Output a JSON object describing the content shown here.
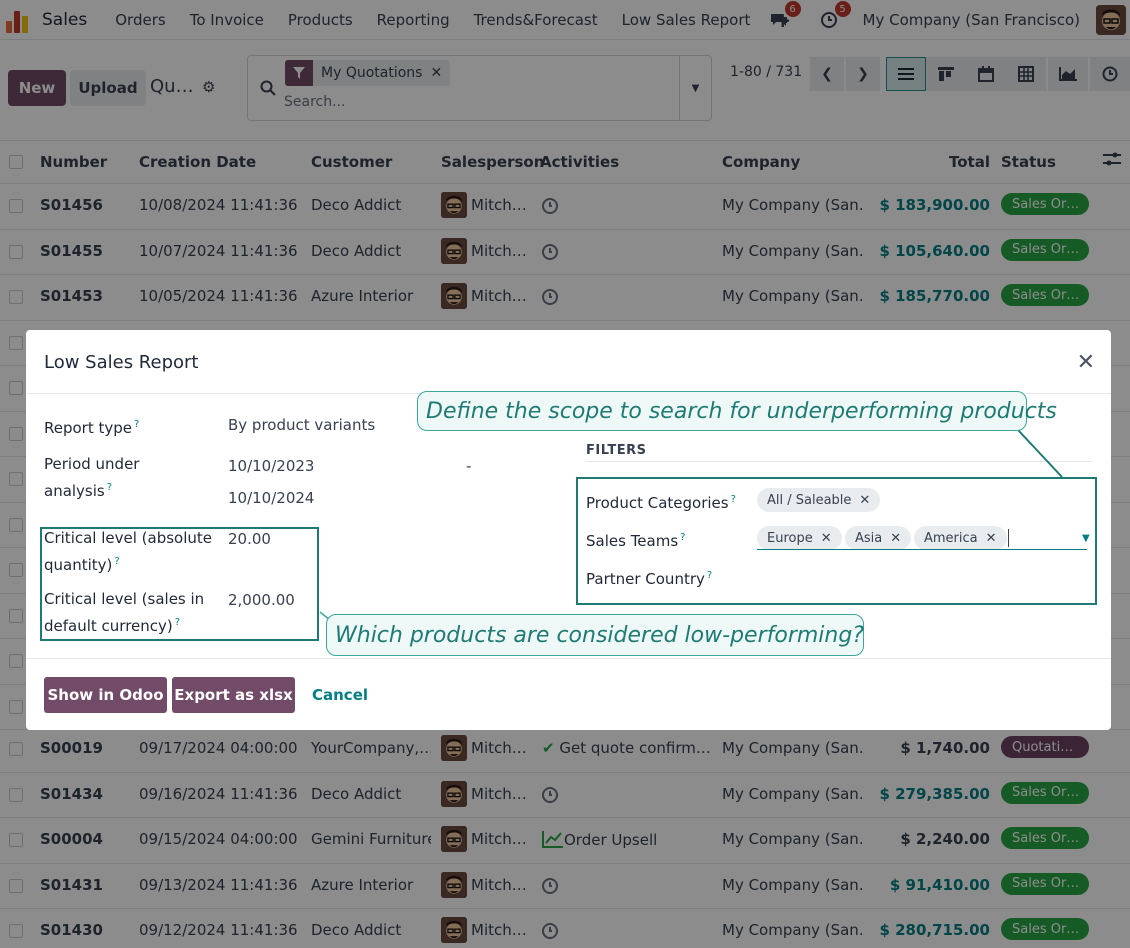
{
  "topnav": {
    "app_name": "Sales",
    "items": [
      "Orders",
      "To Invoice",
      "Products",
      "Reporting",
      "Trends&Forecast",
      "Low Sales Report"
    ],
    "chat_count": "6",
    "activity_count": "5",
    "company": "My Company (San Francisco)"
  },
  "control_panel": {
    "new_label": "New",
    "upload_label": "Upload",
    "title": "Qu…",
    "facet_label": "My Quotations",
    "search_placeholder": "Search...",
    "pager": "1-80 / 731"
  },
  "list": {
    "headers": {
      "number": "Number",
      "creation_date": "Creation Date",
      "customer": "Customer",
      "salesperson": "Salesperson",
      "activities": "Activities",
      "company": "Company",
      "total": "Total",
      "status": "Status"
    },
    "rows": [
      {
        "number": "S01456",
        "date": "10/08/2024 11:41:36",
        "customer": "Deco Addict",
        "salesperson": "Mitch…",
        "activity": "",
        "company": "My Company (San…",
        "total": "$ 183,900.00",
        "status": "Sales Or…"
      },
      {
        "number": "S01455",
        "date": "10/07/2024 11:41:36",
        "customer": "Deco Addict",
        "salesperson": "Mitch…",
        "activity": "",
        "company": "My Company (San…",
        "total": "$ 105,640.00",
        "status": "Sales Or…"
      },
      {
        "number": "S01453",
        "date": "10/05/2024 11:41:36",
        "customer": "Azure Interior",
        "salesperson": "Mitch…",
        "activity": "",
        "company": "My Company (San…",
        "total": "$ 185,770.00",
        "status": "Sales Or…"
      },
      {
        "number": "S00019",
        "date": "09/17/2024 04:00:00",
        "customer": "YourCompany,…",
        "salesperson": "Mitch…",
        "activity": "Get quote confirm…",
        "company": "My Company (San…",
        "total": "$ 1,740.00",
        "status": "Quotati…"
      },
      {
        "number": "S01434",
        "date": "09/16/2024 11:41:36",
        "customer": "Deco Addict",
        "salesperson": "Mitch…",
        "activity": "",
        "company": "My Company (San…",
        "total": "$ 279,385.00",
        "status": "Sales Or…"
      },
      {
        "number": "S00004",
        "date": "09/15/2024 04:00:00",
        "customer": "Gemini Furniture",
        "salesperson": "Mitch…",
        "activity": "Order Upsell",
        "company": "My Company (San…",
        "total": "$ 2,240.00",
        "status": "Sales Or…"
      },
      {
        "number": "S01431",
        "date": "09/13/2024 11:41:36",
        "customer": "Azure Interior",
        "salesperson": "Mitch…",
        "activity": "",
        "company": "My Company (San…",
        "total": "$ 91,410.00",
        "status": "Sales Or…"
      },
      {
        "number": "S01430",
        "date": "09/12/2024 11:41:36",
        "customer": "Deco Addict",
        "salesperson": "Mitch…",
        "activity": "",
        "company": "My Company (San…",
        "total": "$ 280,715.00",
        "status": "Sales Or…"
      }
    ]
  },
  "dialog": {
    "title": "Low Sales Report",
    "report_type_label": "Report type",
    "report_type_value": "By product variants",
    "period_label_1": "Period under",
    "period_label_2": "analysis",
    "period_from": "10/10/2023",
    "period_to": "10/10/2024",
    "period_sep": "-",
    "crit_qty_label_1": "Critical level (absolute",
    "crit_qty_label_2": "quantity)",
    "crit_qty_value": "20.00",
    "crit_sales_label_1": "Critical level (sales in",
    "crit_sales_label_2": "default currency)",
    "crit_sales_value": "2,000.00",
    "filters_title": "FILTERS",
    "product_categories_label": "Product Categories",
    "product_category_tag": "All / Saleable",
    "sales_teams_label": "Sales Teams",
    "sales_team_tags": [
      "Europe",
      "Asia",
      "America"
    ],
    "partner_country_label": "Partner Country",
    "show_button": "Show in Odoo",
    "export_button": "Export as xlsx",
    "cancel_button": "Cancel"
  },
  "callouts": {
    "scope": "Define the scope to search for underperforming products",
    "low": "Which products are considered low-performing?"
  },
  "colors": {
    "brand": "#714b67",
    "accent": "#017e84",
    "status_sales_order": "#28a745",
    "status_quotation": "#6b4361",
    "badge": "#c0392b",
    "callout_border": "#3aa79a"
  }
}
